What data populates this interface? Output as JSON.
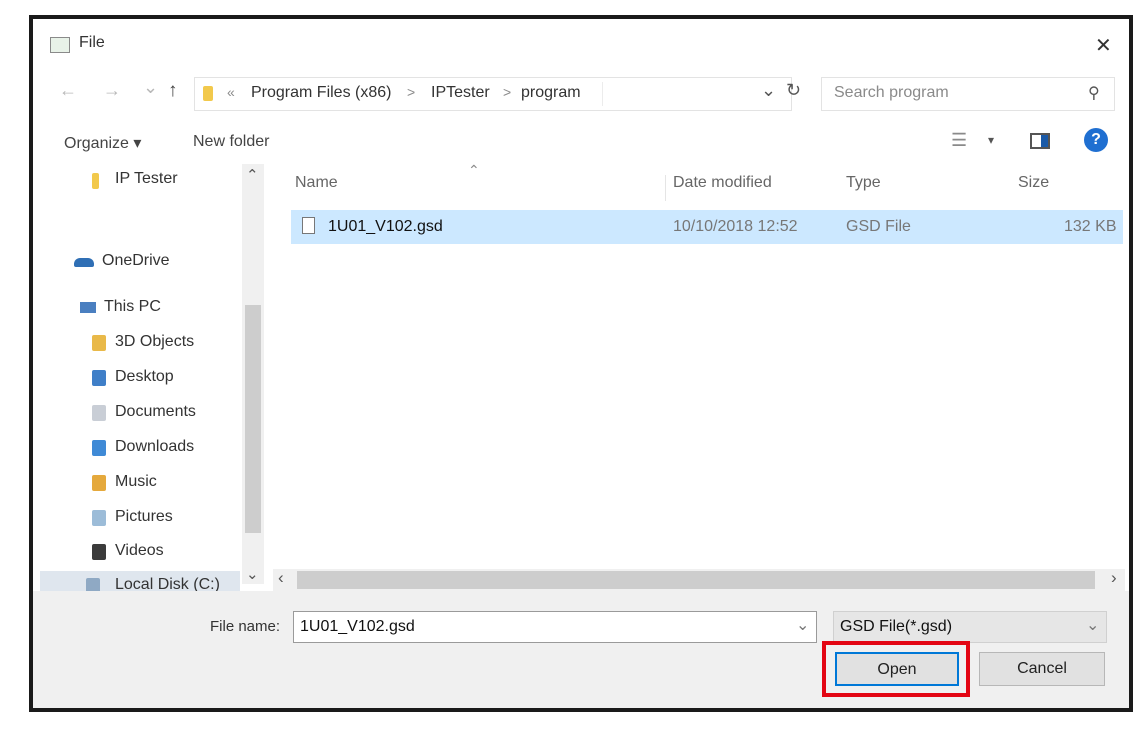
{
  "window": {
    "title": "File",
    "close_glyph": "✕"
  },
  "navigation": {
    "back_glyph": "←",
    "forward_glyph": "→",
    "recent_glyph": "⌄",
    "up_glyph": "↑",
    "separator_glyph": "«",
    "breadcrumb": [
      "Program Files (x86)",
      "IPTester",
      "program"
    ],
    "crumb_sep": ">",
    "dropdown_glyph": "⌄",
    "refresh_glyph": "↻"
  },
  "search": {
    "placeholder": "Search program",
    "icon_glyph": "⚲"
  },
  "toolbar": {
    "organize_label": "Organize ▾",
    "new_folder_label": "New folder",
    "view_glyph": "☰",
    "view_dropdown_glyph": "▾",
    "help_glyph": "?"
  },
  "sidebar": {
    "items": [
      {
        "label": "IP Tester",
        "icon": "folder-icon"
      },
      {
        "label": "OneDrive",
        "icon": "cloud-icon"
      },
      {
        "label": "This PC",
        "icon": "computer-icon"
      },
      {
        "label": "3D Objects",
        "icon": "3d-objects-icon"
      },
      {
        "label": "Desktop",
        "icon": "desktop-icon"
      },
      {
        "label": "Documents",
        "icon": "documents-icon"
      },
      {
        "label": "Downloads",
        "icon": "downloads-icon"
      },
      {
        "label": "Music",
        "icon": "music-icon"
      },
      {
        "label": "Pictures",
        "icon": "pictures-icon"
      },
      {
        "label": "Videos",
        "icon": "videos-icon"
      },
      {
        "label": "Local Disk (C:)",
        "icon": "drive-icon"
      }
    ],
    "scroll_up_glyph": "⌃",
    "scroll_down_glyph": "⌄"
  },
  "file_list": {
    "sort_glyph": "⌃",
    "columns": [
      "Name",
      "Date modified",
      "Type",
      "Size"
    ],
    "rows": [
      {
        "name": "1U01_V102.gsd",
        "date_modified": "10/10/2018 12:52",
        "type": "GSD File",
        "size": "132 KB"
      }
    ],
    "hscroll_left_glyph": "‹",
    "hscroll_right_glyph": "›"
  },
  "footer": {
    "file_name_label": "File name:",
    "file_name_value": "1U01_V102.gsd",
    "file_name_dropdown_glyph": "⌄",
    "file_type_value": "GSD File(*.gsd)",
    "file_type_dropdown_glyph": "⌄",
    "open_label": "Open",
    "cancel_label": "Cancel"
  },
  "colors": {
    "selection": "#cce8ff",
    "highlight_box": "#e30613",
    "accent": "#0078d7",
    "folder": "#f2c94c"
  }
}
